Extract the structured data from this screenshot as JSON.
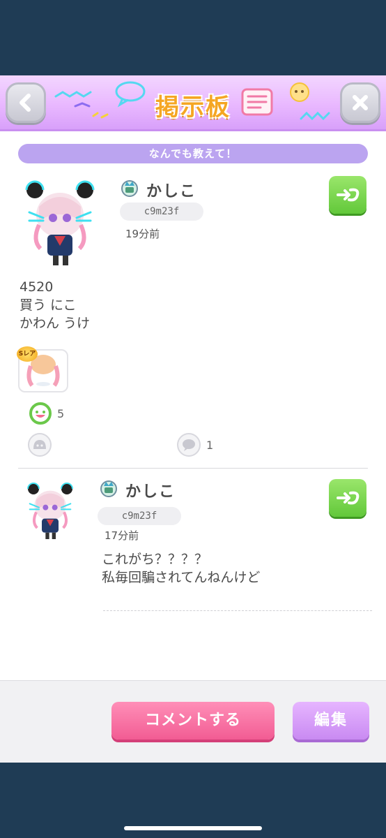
{
  "header": {
    "title": "掲示板",
    "back_icon": "chevron-left-icon",
    "close_icon": "close-icon"
  },
  "topic": {
    "title": "なんでも教えて！"
  },
  "post": {
    "username": "かしこ",
    "user_id": "c9m23f",
    "time": "19分前",
    "text": "4520\n買う にこ\nかわん うけ",
    "item_rarity": "Sレア",
    "smile_count": "5",
    "comment_count": "1"
  },
  "reply": {
    "username": "かしこ",
    "user_id": "c9m23f",
    "time": "17分前",
    "text": "これがち？？？？\n私毎回騙されてんねんけど"
  },
  "footer": {
    "comment_label": "コメントする",
    "edit_label": "編集"
  },
  "colors": {
    "header_bg": "#e9b8ff",
    "topic_bar": "#bba4f0",
    "green_button": "#62c83a",
    "comment_button": "#f25c93",
    "edit_button": "#c98af2",
    "title_text": "#f5a623"
  }
}
